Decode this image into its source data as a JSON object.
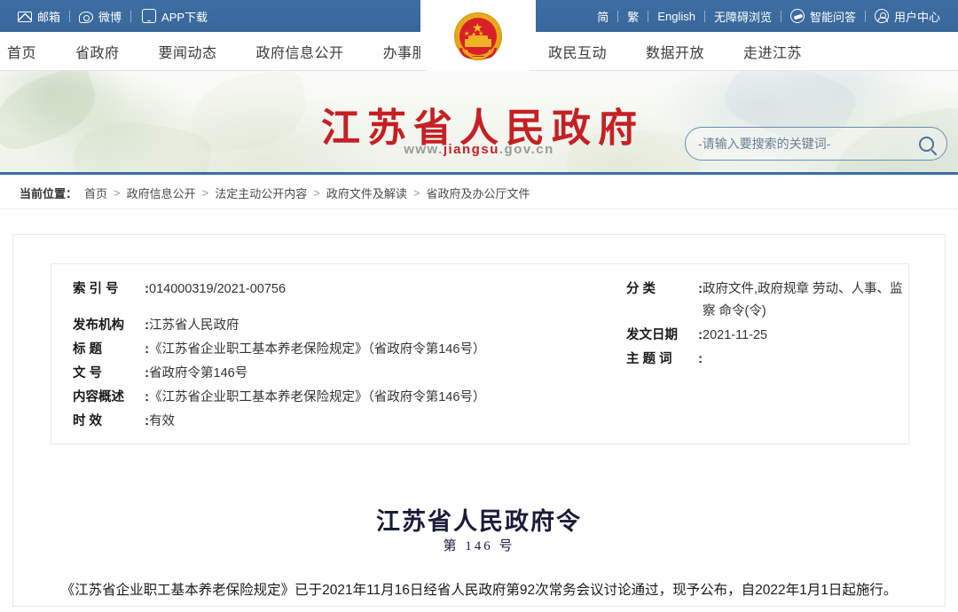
{
  "topbar": {
    "left_items": [
      {
        "label": "邮箱",
        "icon": "mail-icon"
      },
      {
        "label": "微博",
        "icon": "weibo-icon"
      },
      {
        "label": "APP下载",
        "icon": "mobile-icon"
      }
    ],
    "right_items": [
      {
        "label": "简",
        "icon": ""
      },
      {
        "label": "繁",
        "icon": ""
      },
      {
        "label": "English",
        "icon": ""
      },
      {
        "label": "无障碍浏览",
        "icon": ""
      },
      {
        "label": "智能问答",
        "icon": "chat-bubble-icon"
      },
      {
        "label": "用户中心",
        "icon": "user-icon"
      }
    ]
  },
  "nav": {
    "left_items": [
      {
        "label": "首页"
      },
      {
        "label": "省政府"
      },
      {
        "label": "要闻动态"
      },
      {
        "label": "政府信息公开"
      },
      {
        "label": "办事服务"
      }
    ],
    "right_items": [
      {
        "label": "政民互动"
      },
      {
        "label": "数据开放"
      },
      {
        "label": "走进江苏"
      }
    ],
    "emblem_alt": "national-emblem"
  },
  "banner": {
    "title": "江苏省人民政府",
    "url_prefix": "www.",
    "url_brand": "jiangsu",
    "url_suffix": ".gov.cn",
    "url_full": "www.jiangsu.gov.cn",
    "accent_red": "#c52025",
    "accent_blue": "#3a6ea5"
  },
  "search": {
    "placeholder": "-请输入要搜索的关键词-",
    "value": "",
    "button_icon": "search-icon"
  },
  "breadcrumb": {
    "label": "当前位置：",
    "items": [
      "首页",
      "政府信息公开",
      "法定主动公开内容",
      "政府文件及解读",
      "省政府及办公厅文件"
    ],
    "separator": ">"
  },
  "meta": {
    "left": [
      {
        "key": "索 引 号",
        "value": "014000319/2021-00756",
        "spacer": false
      },
      {
        "key": "发布机构",
        "value": "江苏省人民政府",
        "spacer": true
      },
      {
        "key": "标    题",
        "value": "《江苏省企业职工基本养老保险规定》（省政府令第146号）",
        "spacer": false
      },
      {
        "key": "文    号",
        "value": "省政府令第146号",
        "spacer": false
      },
      {
        "key": "内容概述",
        "value": "《江苏省企业职工基本养老保险规定》（省政府令第146号）",
        "spacer": false
      },
      {
        "key": "时    效",
        "value": "有效",
        "spacer": false
      }
    ],
    "right": [
      {
        "key": "分    类",
        "value": "政府文件,政府规章 劳动、人事、监察 命令(令)",
        "spacer": false
      },
      {
        "key": "发文日期",
        "value": "2021-11-25",
        "spacer": false
      },
      {
        "key": "主 题 词",
        "value": "",
        "spacer": false
      }
    ]
  },
  "document": {
    "title": "江苏省人民政府令",
    "number": "第 146 号",
    "paragraph": "《江苏省企业职工基本养老保险规定》已于2021年11月16日经省人民政府第92次常务会议讨论通过，现予公布，自2022年1月1日起施行。"
  }
}
